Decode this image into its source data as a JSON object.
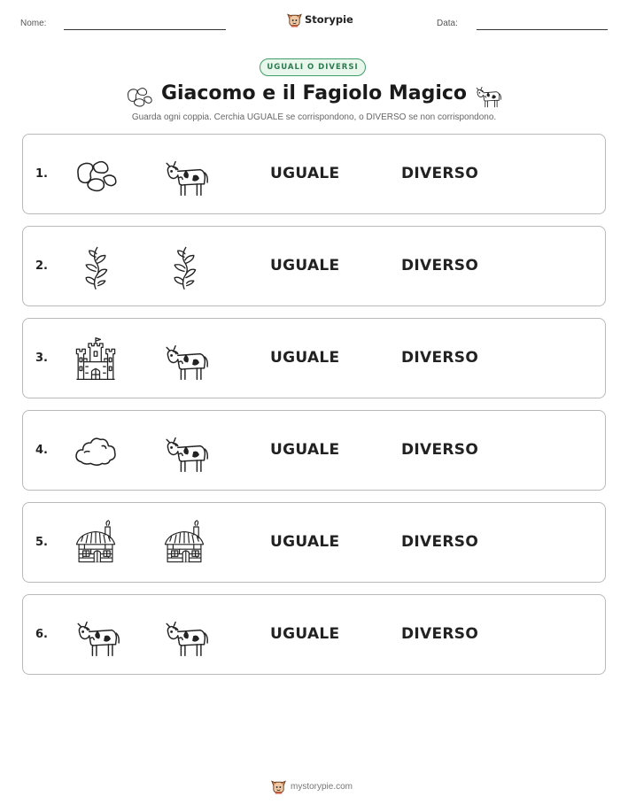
{
  "header": {
    "name_label": "Nome:",
    "date_label": "Data:",
    "brand": "Storypie"
  },
  "badge": "UGUALI O DIVERSI",
  "title": "Giacomo e il Fagiolo Magico",
  "subtitle": "Guarda ogni coppia. Cerchia UGUALE se corrispondono, o DIVERSO se non corrispondono.",
  "options": {
    "same": "UGUALE",
    "different": "DIVERSO"
  },
  "rows": [
    {
      "number": "1.",
      "left_icon": "beans-icon",
      "right_icon": "cow-icon"
    },
    {
      "number": "2.",
      "left_icon": "beanstalk-icon",
      "right_icon": "beanstalk-icon"
    },
    {
      "number": "3.",
      "left_icon": "castle-icon",
      "right_icon": "cow-icon"
    },
    {
      "number": "4.",
      "left_icon": "cloud-icon",
      "right_icon": "cow-icon"
    },
    {
      "number": "5.",
      "left_icon": "cottage-icon",
      "right_icon": "cottage-icon"
    },
    {
      "number": "6.",
      "left_icon": "cow-icon",
      "right_icon": "cow-icon"
    }
  ],
  "footer": {
    "site": "mystorypie.com"
  }
}
